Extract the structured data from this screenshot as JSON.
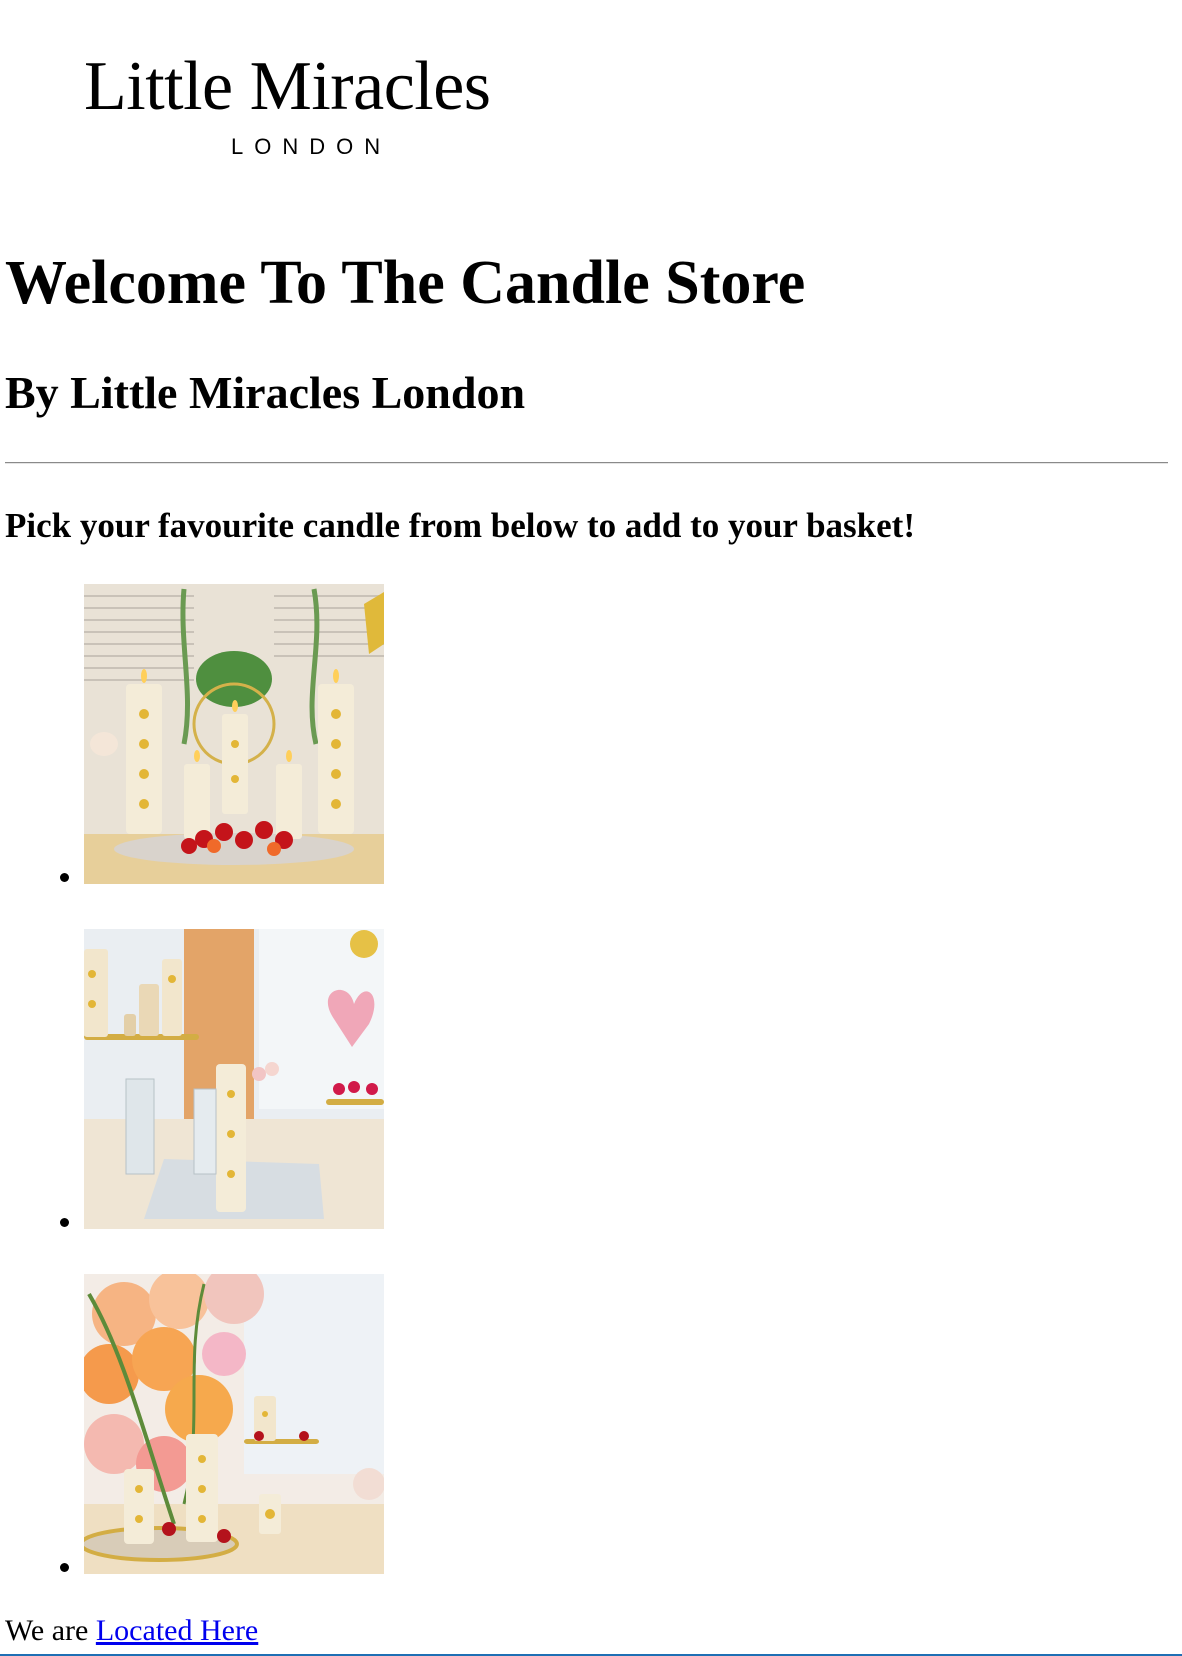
{
  "logo": {
    "name": "Little Miracles",
    "city": "LONDON"
  },
  "heading": "Welcome To The Candle Store",
  "subheading": "By Little Miracles London",
  "prompt": "Pick your favourite candle from below to add to your basket!",
  "products": [
    {
      "image": "candle-table-centerpiece-photo"
    },
    {
      "image": "candle-tiered-stand-photo"
    },
    {
      "image": "candle-balloon-display-photo"
    }
  ],
  "footer": {
    "prefix": "We are",
    "link_text": "Located Here"
  },
  "colors": {
    "link": "#0000ee",
    "text": "#000000",
    "background": "#ffffff"
  }
}
